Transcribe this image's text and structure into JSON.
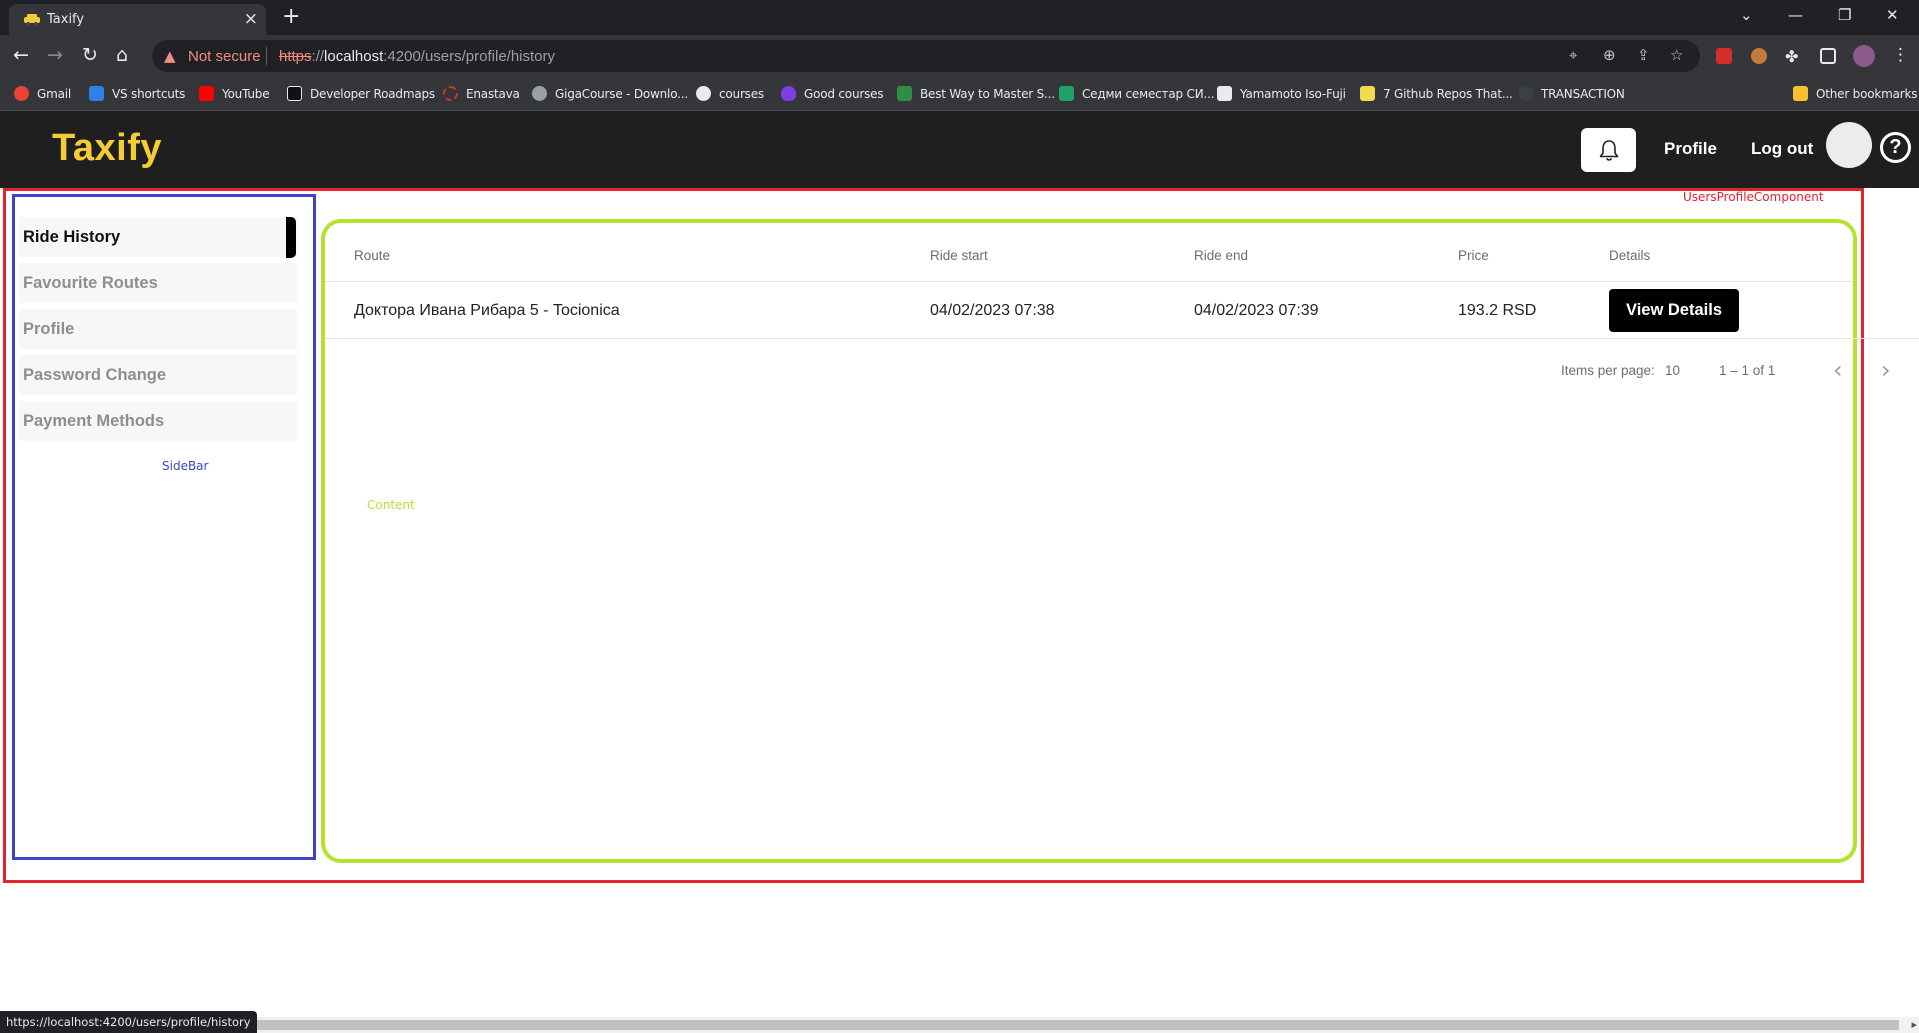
{
  "browser": {
    "tab_title": "Taxify",
    "tab_close": "×",
    "new_tab": "+",
    "security_label": "Not secure",
    "url_scheme": "https",
    "url_separator": "://",
    "url_host": "localhost",
    "url_rest": ":4200/users/profile/history",
    "bookmarks": [
      {
        "label": "Gmail",
        "color": "#ea4335"
      },
      {
        "label": "VS shortcuts",
        "color": "#2f80ed"
      },
      {
        "label": "YouTube",
        "color": "#ff0000"
      },
      {
        "label": "Developer Roadmaps",
        "color": "#111111"
      },
      {
        "label": "Enastava",
        "color": "#d93025"
      },
      {
        "label": "GigaCourse - Downlo...",
        "color": "#9aa0a6"
      },
      {
        "label": "courses",
        "color": "#e8eaed"
      },
      {
        "label": "Good courses",
        "color": "#7b3fe4"
      },
      {
        "label": "Best Way to Master S...",
        "color": "#2f8d46"
      },
      {
        "label": "Седми семестар СИ...",
        "color": "#1fa463"
      },
      {
        "label": "Yamamoto Iso-Fuji",
        "color": "#e8eaed"
      },
      {
        "label": "7 Github Repos That...",
        "color": "#f0db4f"
      },
      {
        "label": "TRANSACTION",
        "color": "#3c4043"
      }
    ],
    "other_bookmarks": "Other bookmarks",
    "status_url": "https://localhost:4200/users/profile/history"
  },
  "header": {
    "logo": "Taxify",
    "profile_link": "Profile",
    "logout_link": "Log out",
    "help_symbol": "?",
    "logo_color": "#f6cc35"
  },
  "debug_labels": {
    "users_profile": "UsersProfileComponent",
    "sidebar": "SideBar",
    "content": "Content"
  },
  "sidebar": {
    "items": [
      {
        "label": "Ride History",
        "active": true
      },
      {
        "label": "Favourite Routes",
        "active": false
      },
      {
        "label": "Profile",
        "active": false
      },
      {
        "label": "Password Change",
        "active": false
      },
      {
        "label": "Payment Methods",
        "active": false
      }
    ]
  },
  "table": {
    "columns": [
      "Route",
      "Ride start",
      "Ride end",
      "Price",
      "Details"
    ],
    "rows": [
      {
        "route": "Доктора Ивана Рибара 5 - Tocionica",
        "ride_start": "04/02/2023 07:38",
        "ride_end": "04/02/2023 07:39",
        "price": "193.2 RSD",
        "details_label": "View Details"
      }
    ]
  },
  "paginator": {
    "items_per_page_label": "Items per page:",
    "items_per_page_value": "10",
    "range_label": "1 – 1 of 1",
    "prev_symbol": "‹",
    "next_symbol": "›"
  }
}
